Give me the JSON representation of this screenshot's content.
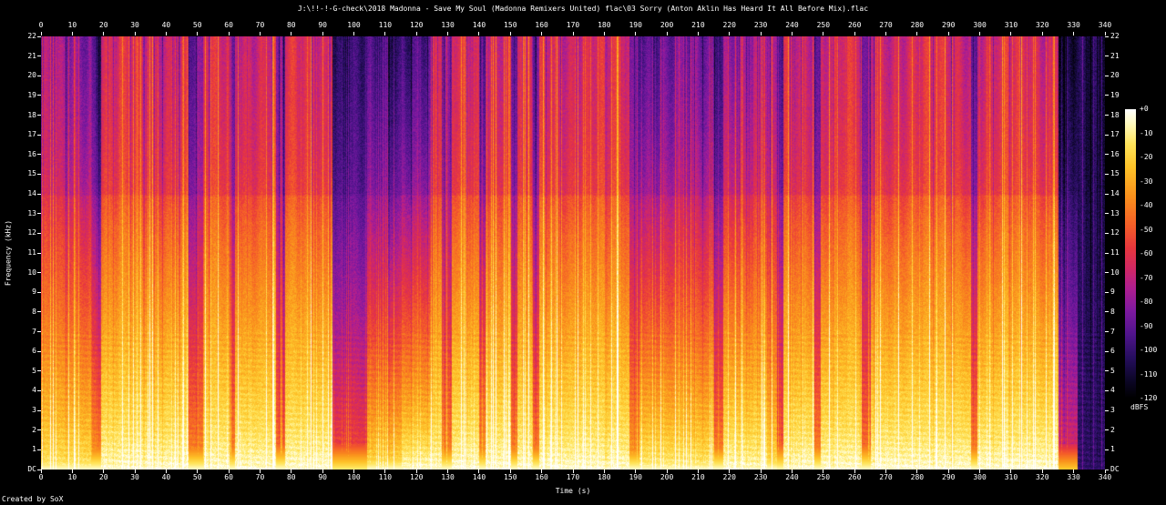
{
  "footer": {
    "created_by": "Created by SoX"
  },
  "chart_data": {
    "type": "heatmap",
    "subtype": "audio-spectrogram",
    "tool": "SoX spectrogram",
    "title": "J:\\!!-!-G-check\\2018 Madonna - Save My Soul (Madonna Remixers United) flac\\03 Sorry (Anton Aklin Has Heard It All Before Mix).flac",
    "xlabel": "Time (s)",
    "ylabel": "Frequency (kHz)",
    "x_range": [
      0,
      340
    ],
    "y_range": [
      0,
      22
    ],
    "x_ticks": [
      "0",
      "10",
      "20",
      "30",
      "40",
      "50",
      "60",
      "70",
      "80",
      "90",
      "100",
      "110",
      "120",
      "130",
      "140",
      "150",
      "160",
      "170",
      "180",
      "190",
      "200",
      "210",
      "220",
      "230",
      "240",
      "250",
      "260",
      "270",
      "280",
      "290",
      "300",
      "310",
      "320",
      "330",
      "340"
    ],
    "y_ticks": [
      "DC",
      "1",
      "2",
      "3",
      "4",
      "5",
      "6",
      "7",
      "8",
      "9",
      "10",
      "11",
      "12",
      "13",
      "14",
      "15",
      "16",
      "17",
      "18",
      "19",
      "20",
      "21",
      "22"
    ],
    "colorbar": {
      "label": "dBFS",
      "ticks": [
        "+0",
        "-10",
        "-20",
        "-30",
        "-40",
        "-50",
        "-60",
        "-70",
        "-80",
        "-90",
        "-100",
        "-110",
        "-120"
      ],
      "max_db": 0,
      "min_db": -120
    },
    "palette": [
      [
        0.0,
        "#000000"
      ],
      [
        0.06,
        "#0c0626"
      ],
      [
        0.14,
        "#260e5f"
      ],
      [
        0.22,
        "#50148c"
      ],
      [
        0.3,
        "#7d19a0"
      ],
      [
        0.38,
        "#af1e91"
      ],
      [
        0.45,
        "#d22864"
      ],
      [
        0.52,
        "#e8373e"
      ],
      [
        0.6,
        "#f55f28"
      ],
      [
        0.7,
        "#fa911c"
      ],
      [
        0.8,
        "#fec328"
      ],
      [
        0.88,
        "#ffe45a"
      ],
      [
        0.95,
        "#fffabe"
      ],
      [
        1.0,
        "#ffffff"
      ]
    ],
    "freq_profile": [
      [
        0,
        0.97
      ],
      [
        0.5,
        0.95
      ],
      [
        1,
        0.93
      ],
      [
        2,
        0.9
      ],
      [
        4,
        0.86
      ],
      [
        6,
        0.82
      ],
      [
        8,
        0.78
      ],
      [
        10,
        0.74
      ],
      [
        12,
        0.7
      ],
      [
        13.9,
        0.65
      ],
      [
        14,
        0.6
      ],
      [
        16,
        0.58
      ],
      [
        18,
        0.565
      ],
      [
        20,
        0.555
      ],
      [
        22,
        0.545
      ]
    ],
    "segments_format": "[t_start_s, t_end_s, low_band_level, high_band_level]",
    "segments": [
      [
        0,
        16,
        0.92,
        0.55
      ],
      [
        16,
        19,
        0.75,
        0.32
      ],
      [
        19,
        47,
        1,
        0.8
      ],
      [
        47,
        52,
        0.7,
        0.35
      ],
      [
        52,
        60,
        1,
        0.8
      ],
      [
        60,
        62,
        0.7,
        0.35
      ],
      [
        62,
        75,
        1,
        0.8
      ],
      [
        75,
        78,
        0.65,
        0.32
      ],
      [
        78,
        93,
        1,
        0.8
      ],
      [
        93,
        104,
        0.55,
        0.12
      ],
      [
        104,
        115,
        0.9,
        0.18
      ],
      [
        115,
        125,
        1,
        0.3
      ],
      [
        125,
        128,
        1,
        0.85
      ],
      [
        128,
        131,
        0.7,
        0.32
      ],
      [
        131,
        140,
        1,
        0.8
      ],
      [
        140,
        142,
        0.75,
        0.4
      ],
      [
        142,
        150,
        1,
        0.8
      ],
      [
        150,
        152,
        0.7,
        0.35
      ],
      [
        152,
        157,
        1,
        0.8
      ],
      [
        157,
        159,
        0.7,
        0.35
      ],
      [
        159,
        188,
        1,
        0.8
      ],
      [
        188,
        191,
        0.75,
        0.4
      ],
      [
        191,
        215,
        0.95,
        0.38
      ],
      [
        215,
        218,
        0.7,
        0.3
      ],
      [
        218,
        232,
        1,
        0.62
      ],
      [
        232,
        235,
        0.9,
        0.5
      ],
      [
        235,
        237,
        0.6,
        0.3
      ],
      [
        237,
        247,
        1,
        0.8
      ],
      [
        247,
        249,
        0.7,
        0.35
      ],
      [
        249,
        262,
        1,
        0.8
      ],
      [
        262,
        265,
        0.65,
        0.3
      ],
      [
        265,
        297,
        1,
        0.8
      ],
      [
        297,
        299,
        0.7,
        0.35
      ],
      [
        299,
        323,
        1,
        0.8
      ],
      [
        323,
        325,
        1,
        0.9
      ],
      [
        325,
        331,
        0.45,
        0.03
      ],
      [
        331,
        340,
        0.02,
        0.01
      ]
    ],
    "description": "Full-bandwidth (0-22 kHz) SoX spectrogram of a ~327 s track: bright yellow/white bass floor, orange mids, crimson highs with purple beat striping; quiet purple breakdowns near 93-125 s and 191-215 s; audio ends ~325-331 s followed by dark silence to 340 s."
  }
}
